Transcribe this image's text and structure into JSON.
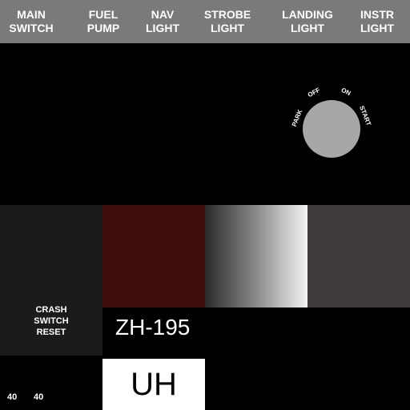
{
  "switches": [
    {
      "line1": "MAIN",
      "line2": "SWITCH"
    },
    {
      "line1": "FUEL",
      "line2": "PUMP"
    },
    {
      "line1": "NAV",
      "line2": "LIGHT"
    },
    {
      "line1": "STROBE",
      "line2": "LIGHT"
    },
    {
      "line1": "LANDING",
      "line2": "LIGHT"
    },
    {
      "line1": "INSTR",
      "line2": "LIGHT"
    }
  ],
  "ignition": {
    "positions": [
      "PARK",
      "OFF",
      "ON",
      "START"
    ]
  },
  "crash_reset": {
    "line1": "CRASH",
    "line2": "SWITCH",
    "line3": "RESET"
  },
  "registration": "ZH-195",
  "callsign": "UH",
  "readouts": [
    "40",
    "40"
  ],
  "colors": {
    "topbar": "#7a7a7a",
    "knob": "#a7a7a7",
    "maroon": "#3f0f0f",
    "panel_dark": "#1b1b1b",
    "panel_grey": "#3d3a39"
  }
}
